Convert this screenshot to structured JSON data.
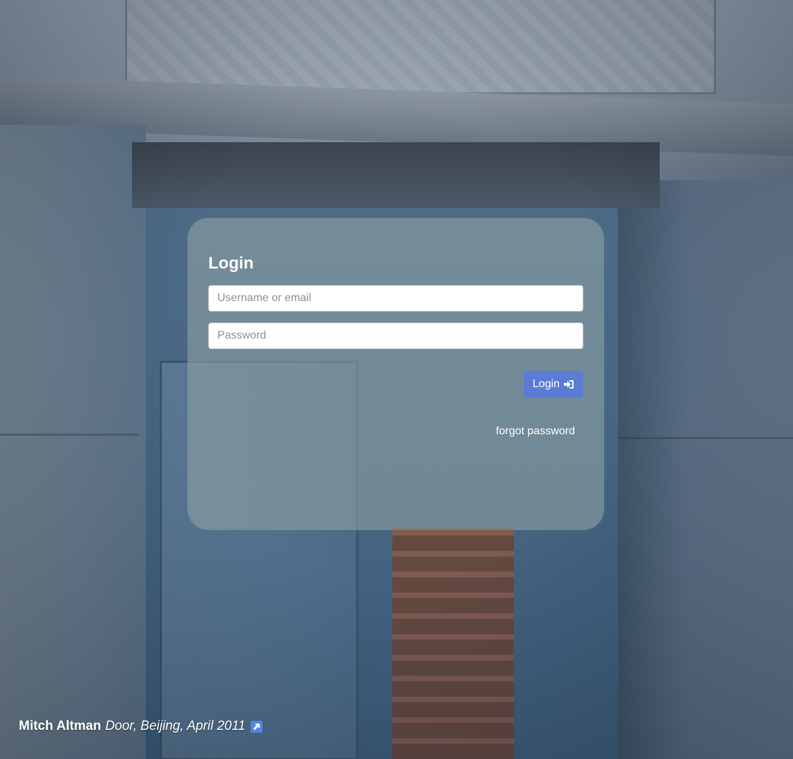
{
  "login": {
    "title": "Login",
    "username_placeholder": "Username or email",
    "password_placeholder": "Password",
    "submit_label": "Login",
    "forgot_label": "forgot password"
  },
  "caption": {
    "author": "Mitch Altman",
    "title": "Door, Beijing, April 2011"
  },
  "colors": {
    "button": "#5b7bd5",
    "external_link_icon": "#4f86e8"
  },
  "icons": {
    "login_submit": "sign-in-icon",
    "caption_link": "external-link-icon"
  }
}
